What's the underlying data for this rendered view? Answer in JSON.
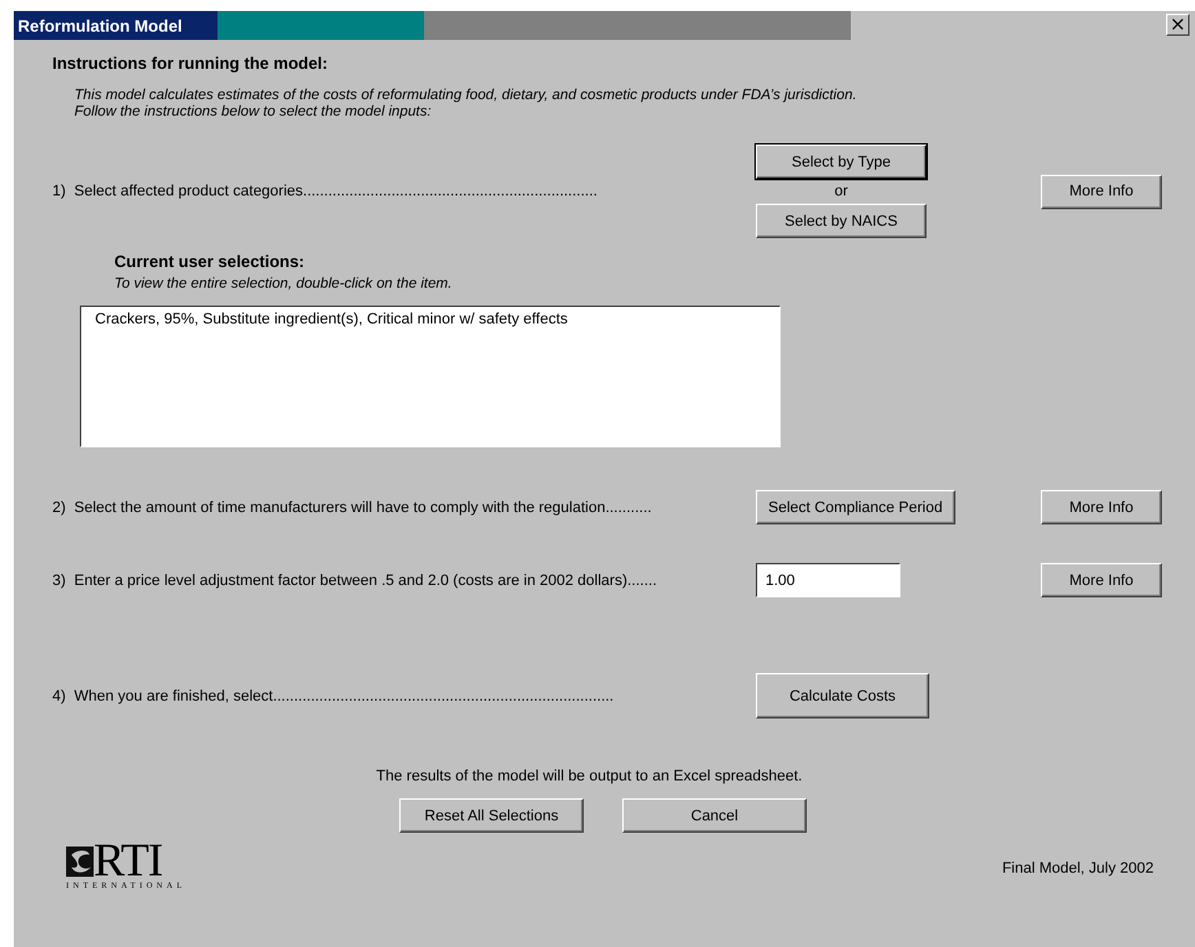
{
  "window": {
    "title": "Reformulation Model",
    "close": "×"
  },
  "heading": "Instructions for running the model:",
  "intro": [
    "This model calculates estimates of the costs of reformulating food, dietary, and cosmetic products under FDA’s jurisdiction.",
    "Follow the instructions below to select the model inputs:"
  ],
  "steps": [
    {
      "kind": "choice",
      "text": "1)  Select affected product categories......................................................................",
      "buttons": [
        {
          "label": "Select by Type",
          "focused": true
        },
        {
          "label": "Select by NAICS",
          "focused": false
        }
      ],
      "separator": "or",
      "more_info": "More Info"
    },
    {
      "kind": "button",
      "text": "2)  Select the amount of time manufacturers will have to comply with the regulation...........",
      "buttons": [
        {
          "label": "Select Compliance Period",
          "focused": false
        }
      ],
      "more_info": "More Info"
    },
    {
      "kind": "input",
      "text": "3)  Enter a price level adjustment factor between .5 and 2.0 (costs are in 2002 dollars).......",
      "value": "1.00",
      "more_info": "More Info"
    },
    {
      "kind": "button",
      "text": "4)  When you are finished, select.................................................................................",
      "buttons": [
        {
          "label": "Calculate Costs",
          "focused": false
        }
      ]
    }
  ],
  "selections": {
    "title": "Current user selections:",
    "hint": "To view the entire selection, double-click on the item.",
    "items": [
      "Crackers, 95%, Substitute ingredient(s), Critical minor w/ safety effects"
    ]
  },
  "note": "The results of the model will be output to an Excel spreadsheet.",
  "footer_buttons": [
    "Reset All Selections",
    "Cancel"
  ],
  "logo": {
    "name": "RTI",
    "subtitle": "INTERNATIONAL"
  },
  "version": "Final Model, July 2002"
}
